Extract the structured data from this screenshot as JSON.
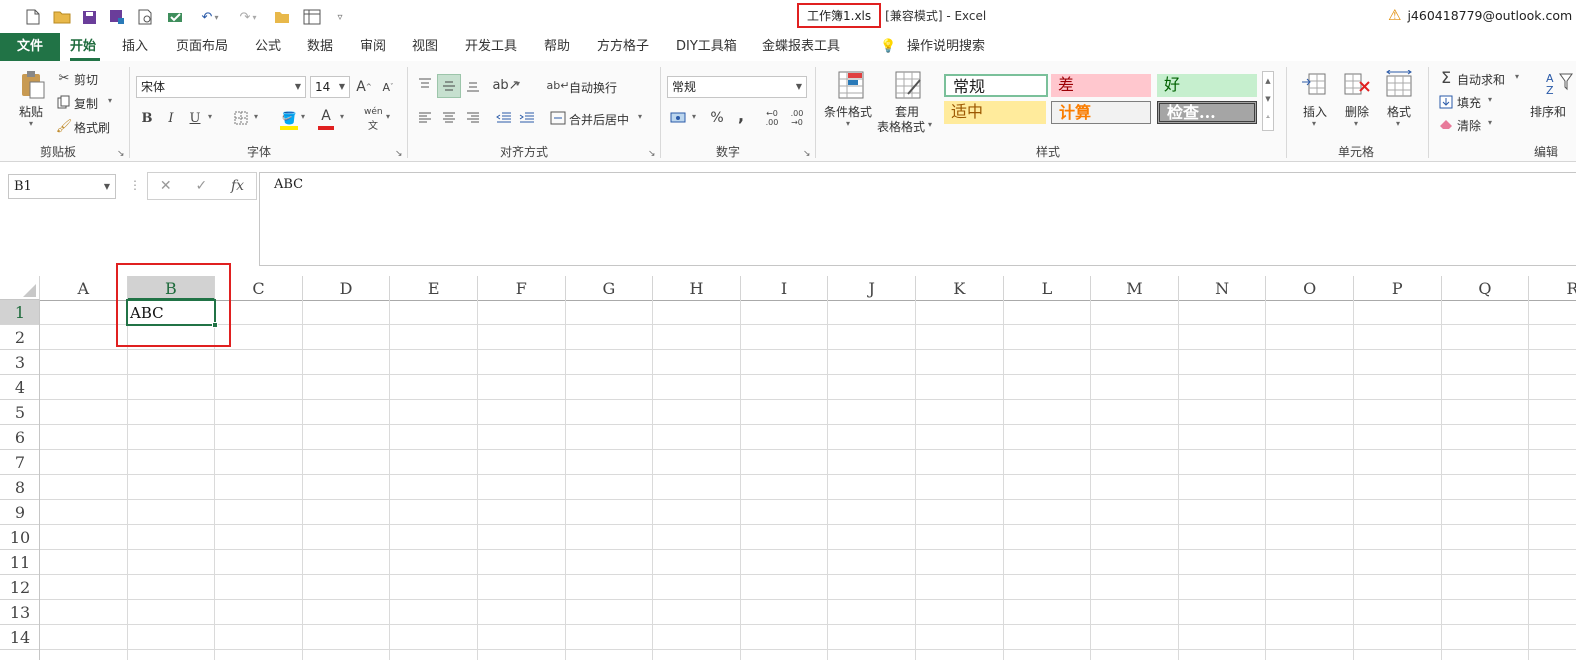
{
  "quick_access": {
    "icons": [
      "new-file-icon",
      "open-folder-icon",
      "save-icon",
      "save-as-icon",
      "print-preview-icon",
      "spell-check-icon",
      "undo-icon",
      "redo-icon",
      "folder-icon",
      "sheet-view-icon",
      "customize-icon"
    ]
  },
  "window": {
    "doc_name": "工作簿1.xls",
    "doc_rest": "[兼容模式]  -  Excel",
    "account": "j460418779@outlook.com"
  },
  "tabs": [
    "文件",
    "开始",
    "插入",
    "页面布局",
    "公式",
    "数据",
    "审阅",
    "视图",
    "开发工具",
    "帮助",
    "方方格子",
    "DIY工具箱",
    "金蝶报表工具",
    "操作说明搜索"
  ],
  "ribbon": {
    "clipboard": {
      "paste": "粘贴",
      "cut": "剪切",
      "copy": "复制",
      "format_painter": "格式刷",
      "label": "剪贴板"
    },
    "font": {
      "name": "宋体",
      "size": "14",
      "bold": "B",
      "italic": "I",
      "underline": "U",
      "wen": "wén",
      "wen2": "文",
      "label": "字体"
    },
    "align": {
      "wrap": "自动换行",
      "merge": "合并后居中",
      "label": "对齐方式"
    },
    "number": {
      "format": "常规",
      "percent": "%",
      "comma": ",",
      "label": "数字"
    },
    "styles": {
      "cond_format": "条件格式",
      "table_format_1": "套用",
      "table_format_2": "表格格式",
      "normal": "常规",
      "bad": "差",
      "good": "好",
      "neutral": "适中",
      "calc": "计算",
      "check": "检查...",
      "label": "样式"
    },
    "cells": {
      "insert": "插入",
      "delete": "删除",
      "format": "格式",
      "label": "单元格"
    },
    "editing": {
      "autosum": "自动求和",
      "fill": "填充",
      "clear": "清除",
      "sort": "排序和",
      "label": "编辑"
    }
  },
  "formula_bar": {
    "name_box": "B1",
    "formula": "ABC",
    "fx": "fx"
  },
  "sheet": {
    "columns": [
      "A",
      "B",
      "C",
      "D",
      "E",
      "F",
      "G",
      "H",
      "I",
      "J",
      "K",
      "L",
      "M",
      "N",
      "O",
      "P",
      "Q",
      "R"
    ],
    "rows": [
      "1",
      "2",
      "3",
      "4",
      "5",
      "6",
      "7",
      "8",
      "9",
      "10",
      "11",
      "12",
      "13",
      "14"
    ],
    "cell_b1": "ABC"
  },
  "colors": {
    "accent": "#217346",
    "highlight": "#e02020"
  }
}
